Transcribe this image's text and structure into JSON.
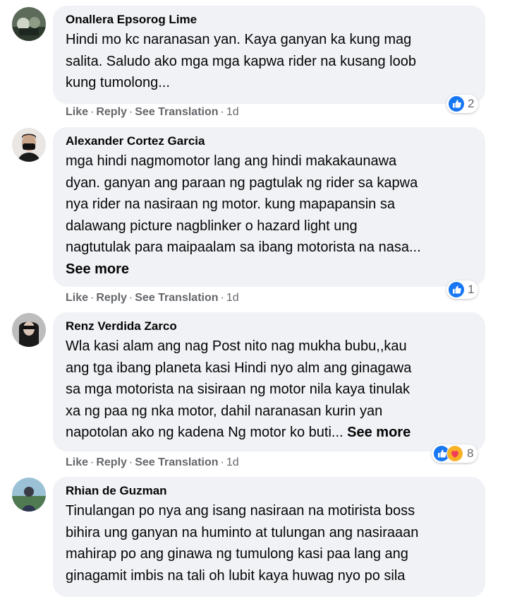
{
  "comments": [
    {
      "author": "Onallera Epsorog Lime",
      "text": "Hindi mo kc naranasan yan. Kaya ganyan ka kung mag\nsalita. Saludo ako mga mga kapwa rider na kusang loob\nkung tumolong...",
      "see_more": "",
      "actions": {
        "like": "Like",
        "reply": "Reply",
        "translate": "See Translation",
        "time": "1d"
      },
      "reactions": {
        "types": [
          "like"
        ],
        "count": "2"
      }
    },
    {
      "author": "Alexander Cortez Garcia",
      "text": "mga hindi nagmomotor lang ang hindi makakaunawa\ndyan. ganyan ang paraan ng pagtulak ng rider sa kapwa\nnya rider na nasiraan ng motor. kung mapapansin sa\ndalawang picture nagblinker o hazard light ung\nnagtutulak para maipaalam sa ibang motorista na nasa...",
      "see_more": "See more",
      "actions": {
        "like": "Like",
        "reply": "Reply",
        "translate": "See Translation",
        "time": "1d"
      },
      "reactions": {
        "types": [
          "like"
        ],
        "count": "1"
      }
    },
    {
      "author": "Renz Verdida Zarco",
      "text": "Wla kasi alam ang nag Post nito nag mukha bubu,,kau\nang tga ibang planeta kasi Hindi nyo alm ang ginagawa\nsa mga motorista na sisiraan ng motor nila kaya tinulak\nxa ng paa ng nka motor, dahil naranasan kurin yan\nnapotolan ako ng kadena Ng motor ko buti... ",
      "see_more": "See more",
      "actions": {
        "like": "Like",
        "reply": "Reply",
        "translate": "See Translation",
        "time": "1d"
      },
      "reactions": {
        "types": [
          "like",
          "care"
        ],
        "count": "8"
      }
    },
    {
      "author": "Rhian de Guzman",
      "text": "Tinulangan po nya ang isang nasiraan na motirista boss\nbihira ung ganyan na huminto at tulungan ang nasiraaan\nmahirap po ang ginawa ng tumulong kasi paa lang ang\nginagamit imbis na tali oh lubit kaya huwag nyo po sila",
      "see_more": "",
      "actions": {
        "like": "",
        "reply": "",
        "translate": "",
        "time": ""
      },
      "reactions": {
        "types": [],
        "count": ""
      }
    }
  ],
  "colors": {
    "bubble": "#f0f2f5",
    "like_blue": "#1877f2",
    "care_red": "#f33e58",
    "meta_grey": "#65676b"
  }
}
